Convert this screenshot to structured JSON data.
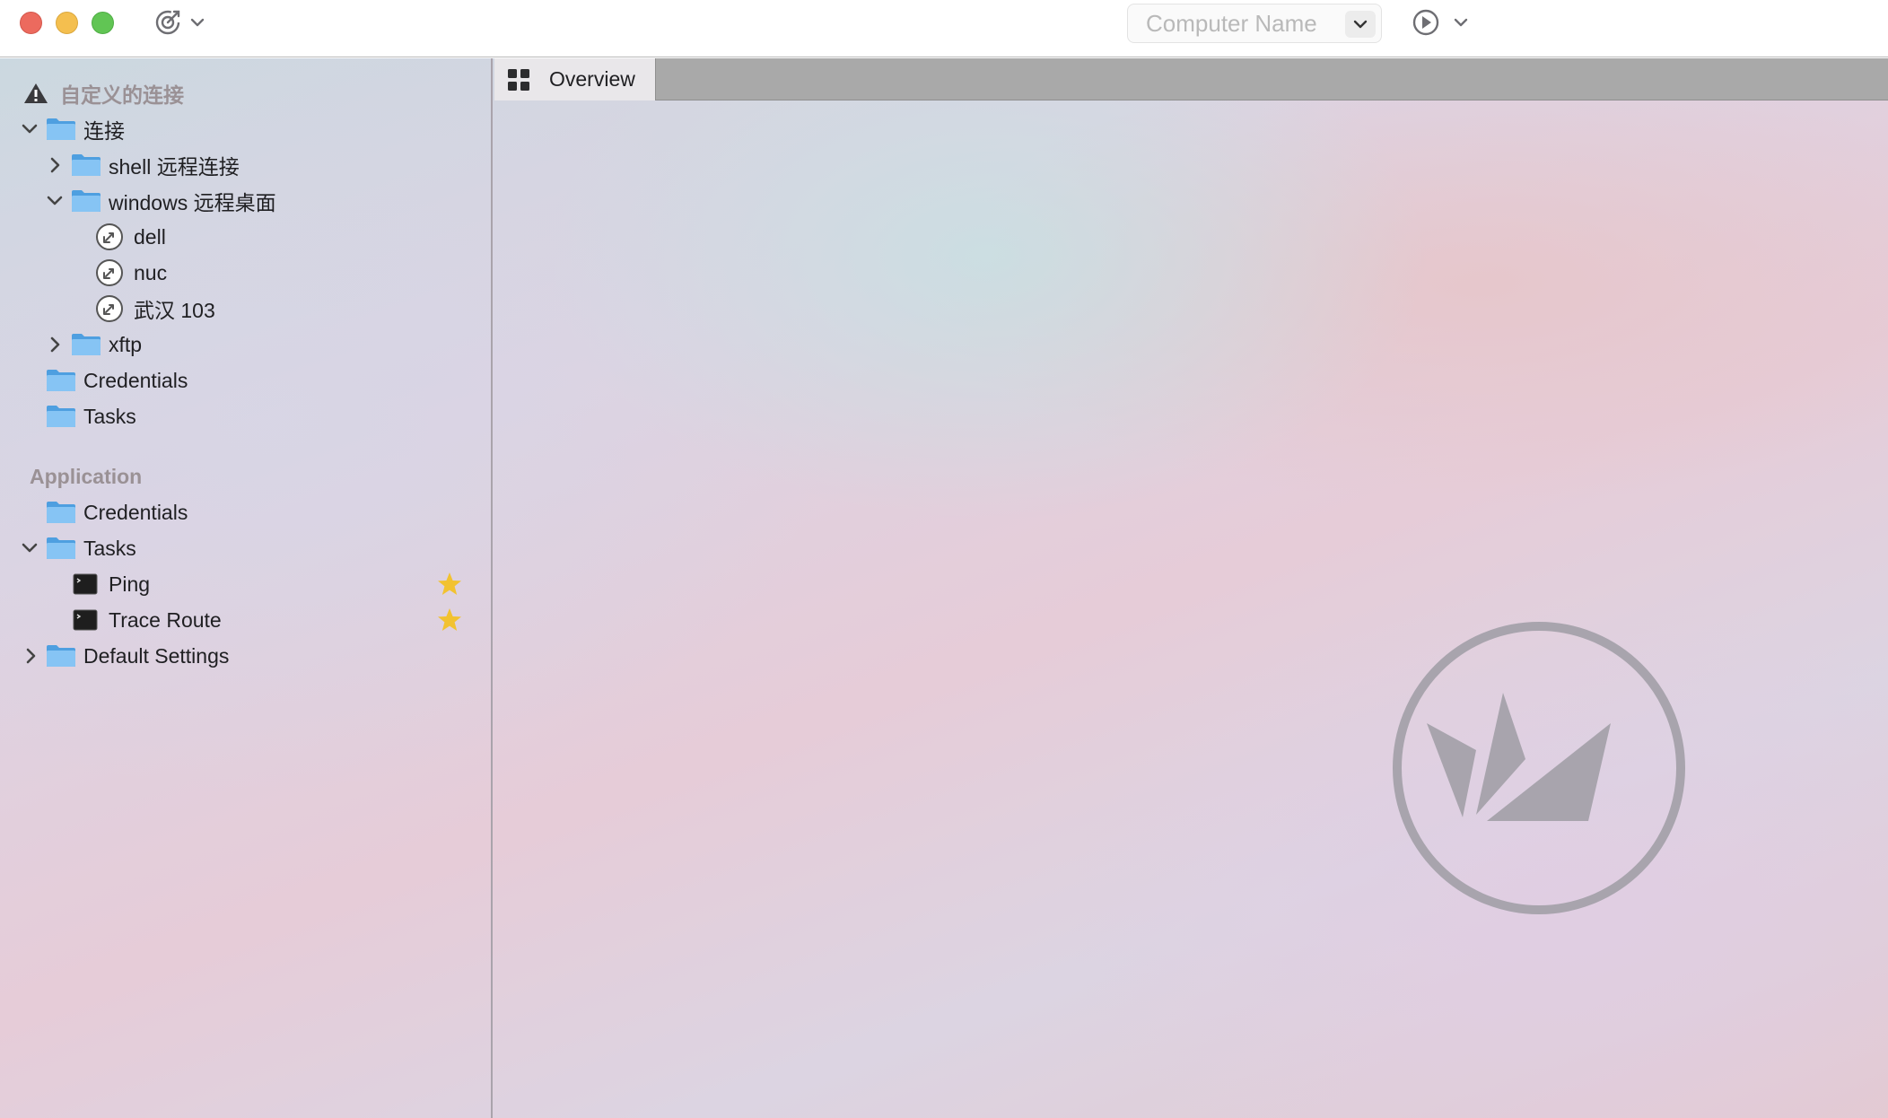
{
  "window": {
    "search": {
      "placeholder": "Computer Name",
      "value": ""
    },
    "icons": {
      "connect": "target-icon",
      "run": "play-circle-icon"
    }
  },
  "sidebar": {
    "custom_section": {
      "title": "自定义的连接",
      "icon": "warning-triangle-icon",
      "items": [
        {
          "label": "连接",
          "expanded": true
        },
        {
          "label": "shell 远程连接",
          "expanded": false
        },
        {
          "label": "windows 远程桌面",
          "expanded": true
        },
        {
          "label": "dell"
        },
        {
          "label": "nuc"
        },
        {
          "label": "武汉 103"
        },
        {
          "label": "xftp",
          "expanded": false
        },
        {
          "label": "Credentials"
        },
        {
          "label": "Tasks"
        }
      ]
    },
    "application_section": {
      "title": "Application",
      "items": [
        {
          "label": "Credentials"
        },
        {
          "label": "Tasks",
          "expanded": true
        },
        {
          "label": "Ping",
          "favorite": true
        },
        {
          "label": "Trace Route",
          "favorite": true
        },
        {
          "label": "Default Settings",
          "expanded": false
        }
      ]
    }
  },
  "tabs": [
    {
      "label": "Overview",
      "icon": "grid-icon",
      "active": true
    }
  ],
  "colors": {
    "close": "#ec6a5e",
    "minimize": "#f4bf4f",
    "maximize": "#61c554",
    "folder": "#7fbff0",
    "star": "#f2c230",
    "logo": "#a8a4ad"
  }
}
